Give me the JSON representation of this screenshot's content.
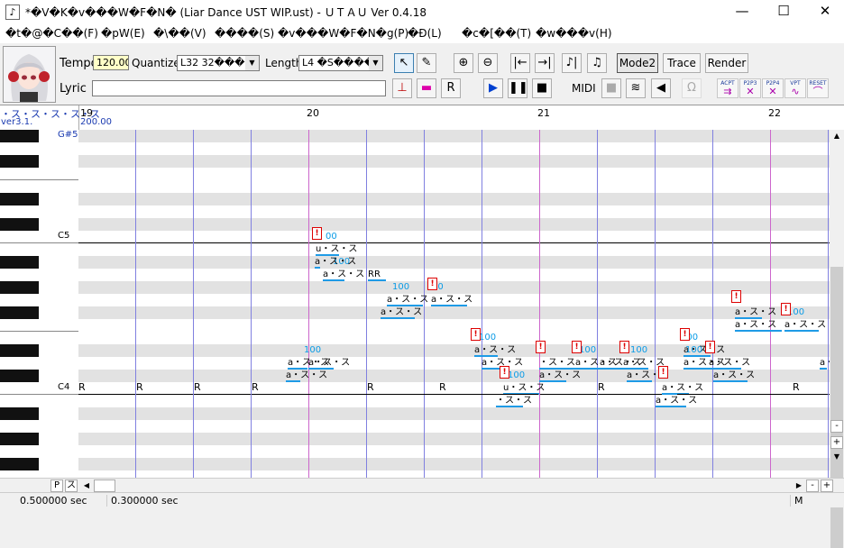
{
  "window": {
    "title": "*�V�K�v���W�F�N� (Liar Dance UST WIP.ust) - ＵＴＡＵ Ver 0.4.18",
    "icon": "♪",
    "minimize": "—",
    "maximize": "☐",
    "close": "✕"
  },
  "menu": [
    "�t�@�C��(F)",
    "�pW(E)",
    "�\\��(V)",
    "����(S)",
    "�v���W�F�N�g(P)",
    "�Ð(L)",
    "�c�[��(T)",
    "�w���v(H)"
  ],
  "toolbar": {
    "tempo_label": "Tempo",
    "tempo_value": "120.00",
    "quantize_label": "Quantize",
    "quantize_value": "L32 32������",
    "length_label": "Length",
    "length_value": "L4 �S����",
    "lyric_label": "Lyric",
    "lyric_value": "",
    "mode2": "Mode2",
    "trace": "Trace",
    "render": "Render",
    "midi": "MIDI",
    "tool_icons": [
      "pointer-icon",
      "pencil-icon",
      "zoom-in-icon",
      "zoom-out-icon",
      "go-start-icon",
      "go-end-icon",
      "split-note-icon",
      "merge-note-icon"
    ],
    "small_buttons": [
      "ACPT",
      "P2P3",
      "P2P4",
      "VPT",
      "RESET"
    ]
  },
  "ruler": {
    "track_name": "・ス・ス・ス・ス・ス",
    "version": "ver3.1.",
    "tempo_mark": "200.00",
    "measures": [
      "19",
      "20",
      "21",
      "22"
    ]
  },
  "keys": {
    "labels": [
      "G#5",
      "C5",
      "C4"
    ]
  },
  "notes": [
    {
      "lyric": "u・ス・ス",
      "vel": "00"
    },
    {
      "lyric": "a・ス・ス",
      "vel": "100"
    },
    {
      "lyric": "RR",
      "vel": ""
    },
    {
      "lyric": "a・ス・ス",
      "vel": "100"
    },
    {
      "lyric": "a・ス・ス",
      "vel": "00"
    },
    {
      "lyric": "a・ス・ス",
      "vel": ""
    },
    {
      "lyric": "a・ス・ス",
      "vel": "100"
    },
    {
      "lyric": "a・ス・ス",
      "vel": ""
    },
    {
      "lyric": "a・ス・ス",
      "vel": "100"
    },
    {
      "lyric": "a・ス・ス",
      "vel": "100"
    },
    {
      "lyric": "a・ス・ス",
      "vel": "100"
    },
    {
      "lyric": "u・ス・ス",
      "vel": "100"
    },
    {
      "lyric": "・ス・ス",
      "vel": ""
    },
    {
      "lyric": "・ス・ス",
      "vel": ""
    },
    {
      "lyric": "a・ス・ス",
      "vel": "100"
    },
    {
      "lyric": "a・ス・ス",
      "vel": ""
    },
    {
      "lyric": "a・ス・ス",
      "vel": "100"
    },
    {
      "lyric": "a・ス・ス",
      "vel": "100"
    },
    {
      "lyric": "a・ス・ス",
      "vel": "100"
    },
    {
      "lyric": "a・ス・ス",
      "vel": "100"
    },
    {
      "lyric": "a・ス・ス",
      "vel": "100"
    },
    {
      "lyric": "a・ス・ス",
      "vel": ""
    },
    {
      "lyric": "a・ス・ス",
      "vel": "100"
    },
    {
      "lyric": "a・ス・ス",
      "vel": ""
    },
    {
      "lyric": "a・ス・ス",
      "vel": "100"
    },
    {
      "lyric": "a・ス・ス",
      "vel": "100"
    },
    {
      "lyric": "a・ス・ス",
      "vel": ""
    },
    {
      "lyric": "a・ス・ス",
      "vel": "100"
    },
    {
      "lyric": "a・ス・ス",
      "vel": ""
    },
    {
      "lyric": "a・ス・ス",
      "vel": ""
    }
  ],
  "rests": [
    "R",
    "R",
    "R",
    "R",
    "R",
    "R",
    "R",
    "R"
  ],
  "warning_mark": "!",
  "status": {
    "time1": "0.500000 sec",
    "time2": "0.300000 sec",
    "mode": "M",
    "p": "P",
    "s": "ス"
  },
  "colors": {
    "note_bar": "#1f9be6",
    "measure_line": "#cc66cc",
    "beat_line": "#8080e0",
    "warning": "#dd0000",
    "tempo_bg": "#ffffc8"
  }
}
